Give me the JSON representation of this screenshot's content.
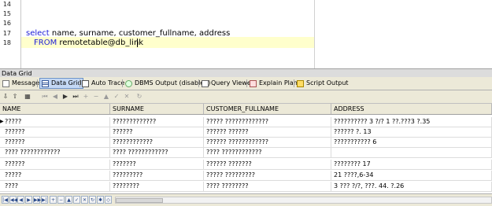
{
  "editor": {
    "line_numbers": [
      "14",
      "15",
      "16",
      "17",
      "18"
    ],
    "line1_kw": "select",
    "line1_rest": " name, surname, customer_fullname, address",
    "line2_kw": "FROM",
    "line2_rest": " remotetable@db_link"
  },
  "panel": {
    "title": "Data Grid"
  },
  "tabs": [
    {
      "label": "Messages",
      "icon": "messages-icon"
    },
    {
      "label": "Data Grid",
      "icon": "grid-icon",
      "active": true
    },
    {
      "label": "Auto Trace",
      "icon": "trace-icon"
    },
    {
      "label": "DBMS Output (disabled)",
      "icon": "dbms-output-icon"
    },
    {
      "label": "Query Viewer",
      "icon": "query-viewer-icon"
    },
    {
      "label": "Explain Plan",
      "icon": "explain-plan-icon"
    },
    {
      "label": "Script Output",
      "icon": "script-output-icon"
    }
  ],
  "grid": {
    "columns": [
      "NAME",
      "SURNAME",
      "CUSTOMER_FULLNAME",
      "ADDRESS"
    ],
    "rows": [
      [
        "?????",
        "?????????????",
        "????? ?????????????",
        "?????????? 3 ?/? 1 ??.???3 ?.35"
      ],
      [
        "??????",
        "??????",
        "?????? ??????",
        "?????? ?. 13"
      ],
      [
        "??????",
        "????????????",
        "?????? ????????????",
        "??????????? 6"
      ],
      [
        "???? ????????????",
        "???? ????????????",
        "???? ????????????",
        ""
      ],
      [
        "??????",
        "???????",
        "?????? ???????",
        "???????? 17"
      ],
      [
        "?????",
        "?????????",
        "????? ?????????",
        "21 ????,6-34"
      ],
      [
        "????",
        "????????",
        "???? ????????",
        "3 ??? ?/?, ???. 44. ?.26"
      ]
    ]
  },
  "colors": {
    "keyword": "#1d1dd6",
    "current_line": "#ffffcc",
    "chrome": "#ece9d8",
    "active_tab": "#c4d8f4"
  }
}
